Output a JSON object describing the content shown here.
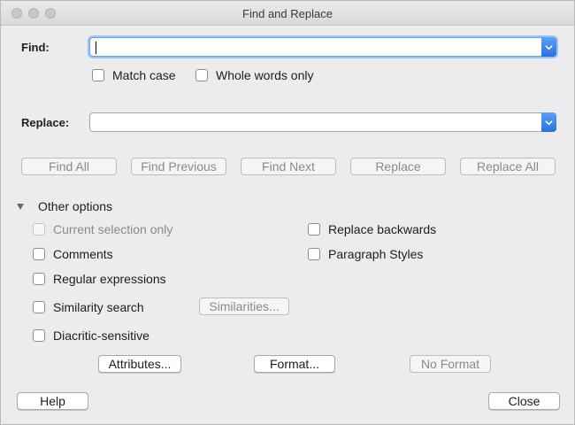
{
  "window": {
    "title": "Find and Replace"
  },
  "find": {
    "label": "Find:",
    "value": "",
    "placeholder": ""
  },
  "find_options": {
    "match_case": "Match case",
    "whole_words": "Whole words only"
  },
  "replace": {
    "label": "Replace:",
    "value": ""
  },
  "actions": {
    "find_all": "Find All",
    "find_previous": "Find Previous",
    "find_next": "Find Next",
    "replace": "Replace",
    "replace_all": "Replace All"
  },
  "other_options": {
    "label": "Other options",
    "current_selection_only": "Current selection only",
    "replace_backwards": "Replace backwards",
    "comments": "Comments",
    "paragraph_styles": "Paragraph Styles",
    "regular_expressions": "Regular expressions",
    "similarity_search": "Similarity search",
    "similarities_button": "Similarities...",
    "diacritic_sensitive": "Diacritic-sensitive",
    "attributes_button": "Attributes...",
    "format_button": "Format...",
    "no_format_button": "No Format"
  },
  "footer": {
    "help": "Help",
    "close": "Close"
  },
  "colors": {
    "accent": "#2a6ee6",
    "focus_ring": "#9cc3f1"
  }
}
